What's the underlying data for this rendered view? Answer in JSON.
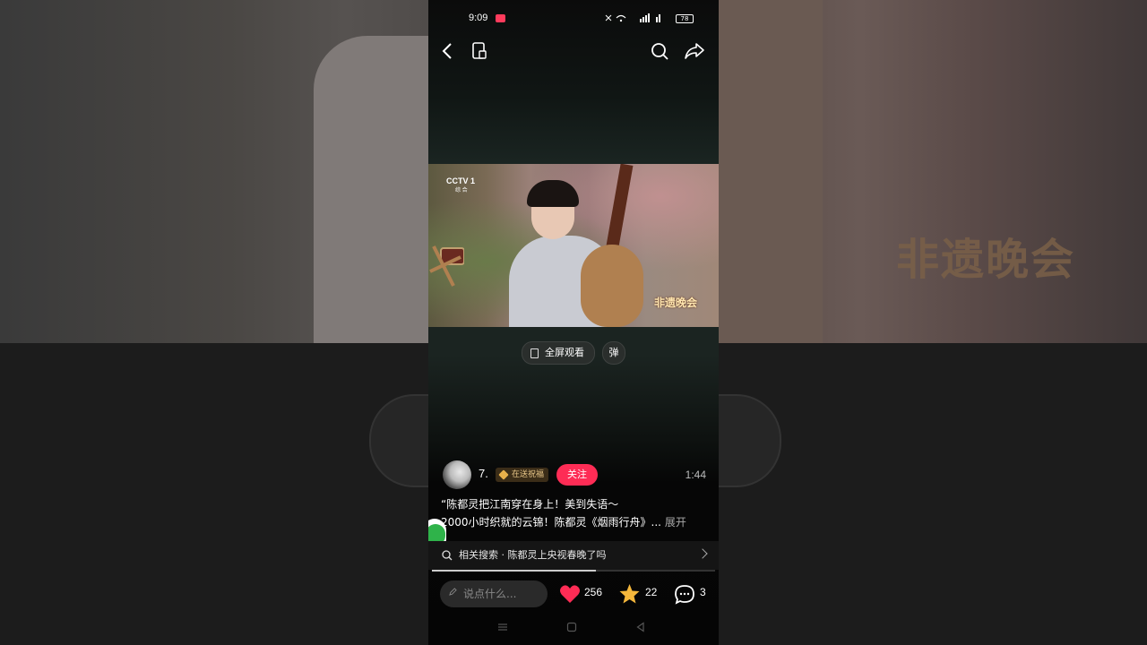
{
  "status_bar": {
    "time": "9:09",
    "battery": "78"
  },
  "video": {
    "channel": "CCTV 1",
    "channel_sub": "综 合",
    "watermark": "非遗晚会"
  },
  "controls": {
    "fullscreen_label": "全屏观看",
    "danmu_label": "弹"
  },
  "author": {
    "name": "7.",
    "tag": "在送祝福",
    "follow_label": "关注",
    "duration": "1:44"
  },
  "description": {
    "line1": "“陈都灵把江南穿在身上！美到失语～",
    "line2": "2000小时织就的云锦！陈都灵《烟雨行舟》...",
    "more": "展开"
  },
  "related_search": "相关搜索 · 陈都灵上央视春晚了吗",
  "progress": 0.58,
  "bottom_bar": {
    "comment_placeholder": "说点什么...",
    "likes": "256",
    "favorites": "22",
    "comments": "3"
  },
  "colors": {
    "accent": "#fe2c55",
    "like": "#fe2c55",
    "favorite": "#f5b73b"
  },
  "background_logo": "非遗晚会"
}
